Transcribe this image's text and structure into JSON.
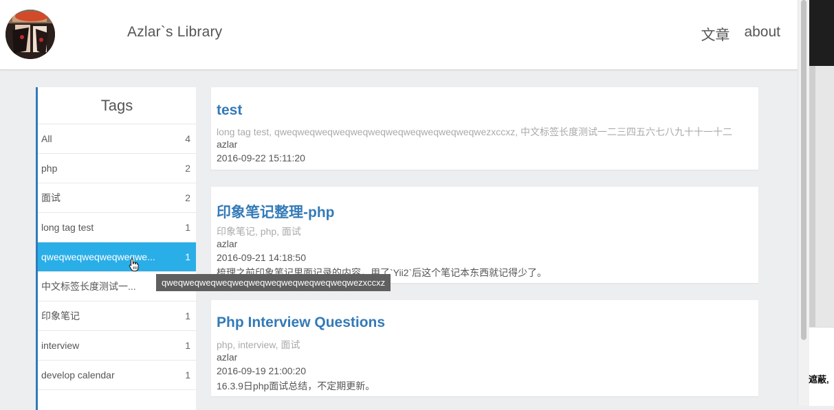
{
  "header": {
    "brand": "Azlar`s Library",
    "nav": [
      "文章",
      "about"
    ]
  },
  "tags": {
    "title": "Tags",
    "items": [
      {
        "label": "All",
        "count": "4"
      },
      {
        "label": "php",
        "count": "2"
      },
      {
        "label": "面试",
        "count": "2"
      },
      {
        "label": "long tag test",
        "count": "1"
      },
      {
        "label": "qweqweqweqweqweqwe...",
        "count": "1"
      },
      {
        "label": "中文标签长度测试一...",
        "count": ""
      },
      {
        "label": "印象笔记",
        "count": "1"
      },
      {
        "label": "interview",
        "count": "1"
      },
      {
        "label": "develop calendar",
        "count": "1"
      }
    ],
    "tooltip": "qweqweqweqweqweqweqweqweqweqweqweqwezxccxz"
  },
  "posts": [
    {
      "title": "test",
      "tags": "long tag test, qweqweqweqweqweqweqweqweqweqweqweqwezxccxz, 中文标签长度测试一二三四五六七八九十十一十二",
      "author": "azlar",
      "date": "2016-09-22 15:11:20",
      "summary": ""
    },
    {
      "title": "印象笔记整理-php",
      "tags": "印象笔记, php, 面试",
      "author": "azlar",
      "date": "2016-09-21 14:18:50",
      "summary": "梳理之前印象笔记里面记录的内容，用了`Yii2`后这个笔记本东西就记得少了。"
    },
    {
      "title": "Php Interview Questions",
      "tags": "php, interview, 面试",
      "author": "azlar",
      "date": "2016-09-19 21:00:20",
      "summary": "16.3.9日php面试总结，不定期更新。"
    }
  ],
  "side_panel": {
    "text": "遮蔽,"
  },
  "colors": {
    "link": "#337ab7",
    "active_tag": "#2aaee8",
    "tooltip_bg": "#5f5f5f"
  }
}
